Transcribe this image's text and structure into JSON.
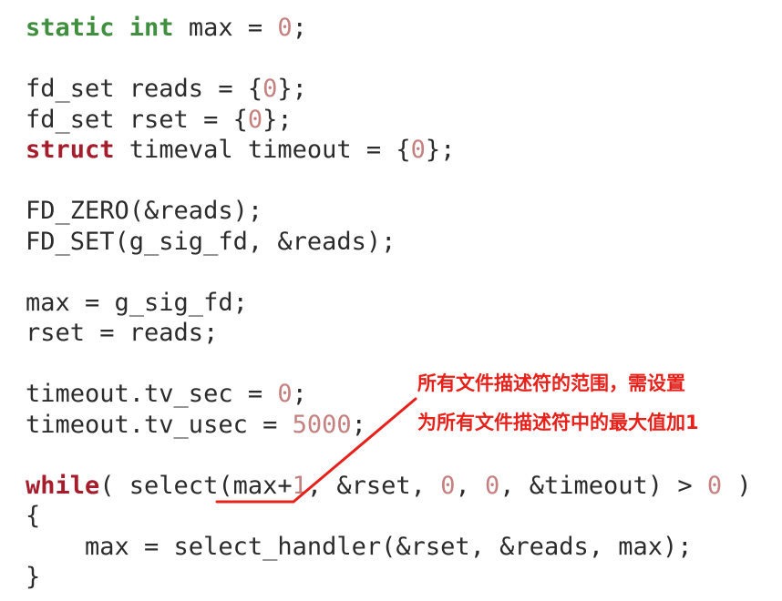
{
  "code": {
    "l1": {
      "kw": "static int",
      "rest": " max = ",
      "num": "0",
      "end": ";"
    },
    "l3": {
      "a": "fd_set reads = {",
      "num": "0",
      "end": "};"
    },
    "l4": {
      "a": "fd_set rset = {",
      "num": "0",
      "end": "};"
    },
    "l5": {
      "kw": "struct",
      "a": " timeval timeout = {",
      "num": "0",
      "end": "};"
    },
    "l7": "FD_ZERO(&reads);",
    "l8": "FD_SET(g_sig_fd, &reads);",
    "l10": "max = g_sig_fd;",
    "l11": "rset = reads;",
    "l13": {
      "a": "timeout.tv_sec = ",
      "num": "0",
      "end": ";"
    },
    "l14": {
      "a": "timeout.tv_usec = ",
      "num": "5000",
      "end": ";"
    },
    "l16": {
      "kw": "while",
      "a": "( select(",
      "hl_text": "max+",
      "hl_num": "1",
      "b": ", &rset, ",
      "n1": "0",
      "c": ", ",
      "n2": "0",
      "d": ", &timeout) > ",
      "n3": "0",
      "e": " )"
    },
    "l17": "{",
    "l18": "    max = select_handler(&rset, &reads, max);",
    "l19": "}"
  },
  "annotation": {
    "line1": "所有文件描述符的范围，需设置",
    "line2": "为所有文件描述符中的最大值加1",
    "color": "#e8201a"
  }
}
